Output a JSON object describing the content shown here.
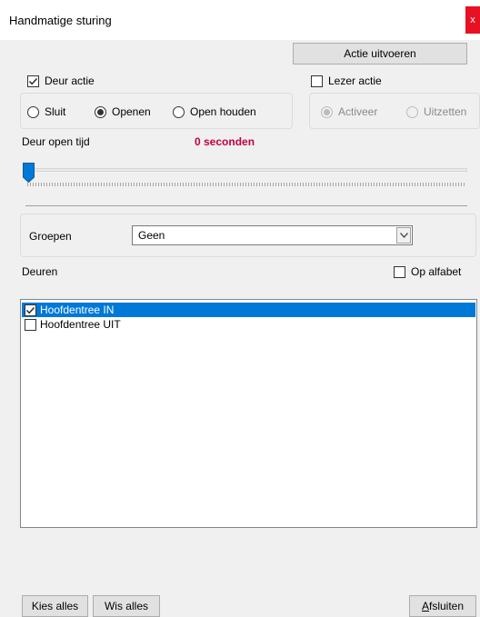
{
  "window": {
    "title": "Handmatige sturing",
    "close_label": "x"
  },
  "actions": {
    "execute_label": "Actie uitvoeren"
  },
  "door_action": {
    "label": "Deur actie",
    "checked": true,
    "options": [
      {
        "label": "Sluit",
        "selected": false
      },
      {
        "label": "Openen",
        "selected": true
      },
      {
        "label": "Open houden",
        "selected": false
      }
    ]
  },
  "reader_action": {
    "label": "Lezer actie",
    "checked": false,
    "options": [
      {
        "label": "Activeer",
        "selected": true
      },
      {
        "label": "Uitzetten",
        "selected": false
      }
    ]
  },
  "open_time": {
    "label": "Deur open tijd",
    "value_text": "0 seconden",
    "slider_fraction": 0,
    "value_color": "#c0003c"
  },
  "groups": {
    "label": "Groepen",
    "selected": "Geen"
  },
  "doors": {
    "label": "Deuren",
    "sort_label": "Op alfabet",
    "sort_checked": false,
    "items": [
      {
        "label": "Hoofdentree IN",
        "checked": true,
        "selected": true
      },
      {
        "label": "Hoofdentree UIT",
        "checked": false,
        "selected": false
      }
    ]
  },
  "footer": {
    "select_all_label": "Kies alles",
    "clear_all_label": "Wis alles",
    "close_label": "Afsluiten"
  },
  "colors": {
    "selection": "#0078d7",
    "close_button": "#e81123",
    "slider_thumb": "#0078d7"
  }
}
